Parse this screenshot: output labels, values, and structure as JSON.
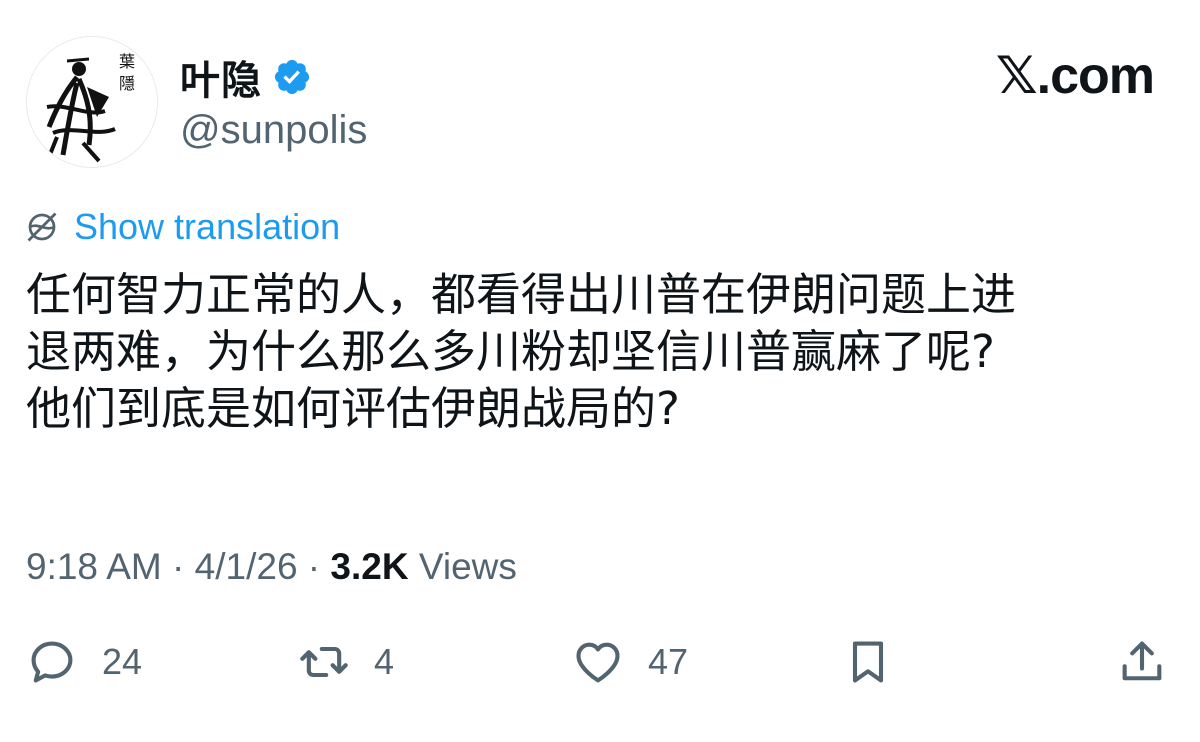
{
  "author": {
    "display_name": "叶隐",
    "handle": "@sunpolis",
    "avatar_icon": "ink-figure-avatar",
    "verified_icon": "verified-badge-icon",
    "verified_color": "#1d9bf0"
  },
  "brand": {
    "label": "𝕏.com"
  },
  "translation": {
    "label": "Show translation",
    "icon": "globe-icon",
    "color": "#1d9bf0"
  },
  "tweet": {
    "lines": [
      "任何智力正常的人，都看得出川普在伊朗问题上进",
      "退两难，为什么那么多川粉却坚信川普赢麻了呢?",
      "他们到底是如何评估伊朗战局的?"
    ]
  },
  "meta": {
    "time": "9:18 AM",
    "sep1": " · ",
    "date": "4/1/26",
    "sep2": " · ",
    "views_count": "3.2K",
    "views_label": " Views"
  },
  "actions": {
    "reply": {
      "icon": "reply-icon",
      "count": "24"
    },
    "repost": {
      "icon": "repost-icon",
      "count": "4"
    },
    "like": {
      "icon": "heart-icon",
      "count": "47"
    },
    "bookmark": {
      "icon": "bookmark-icon"
    },
    "share": {
      "icon": "share-icon"
    }
  }
}
